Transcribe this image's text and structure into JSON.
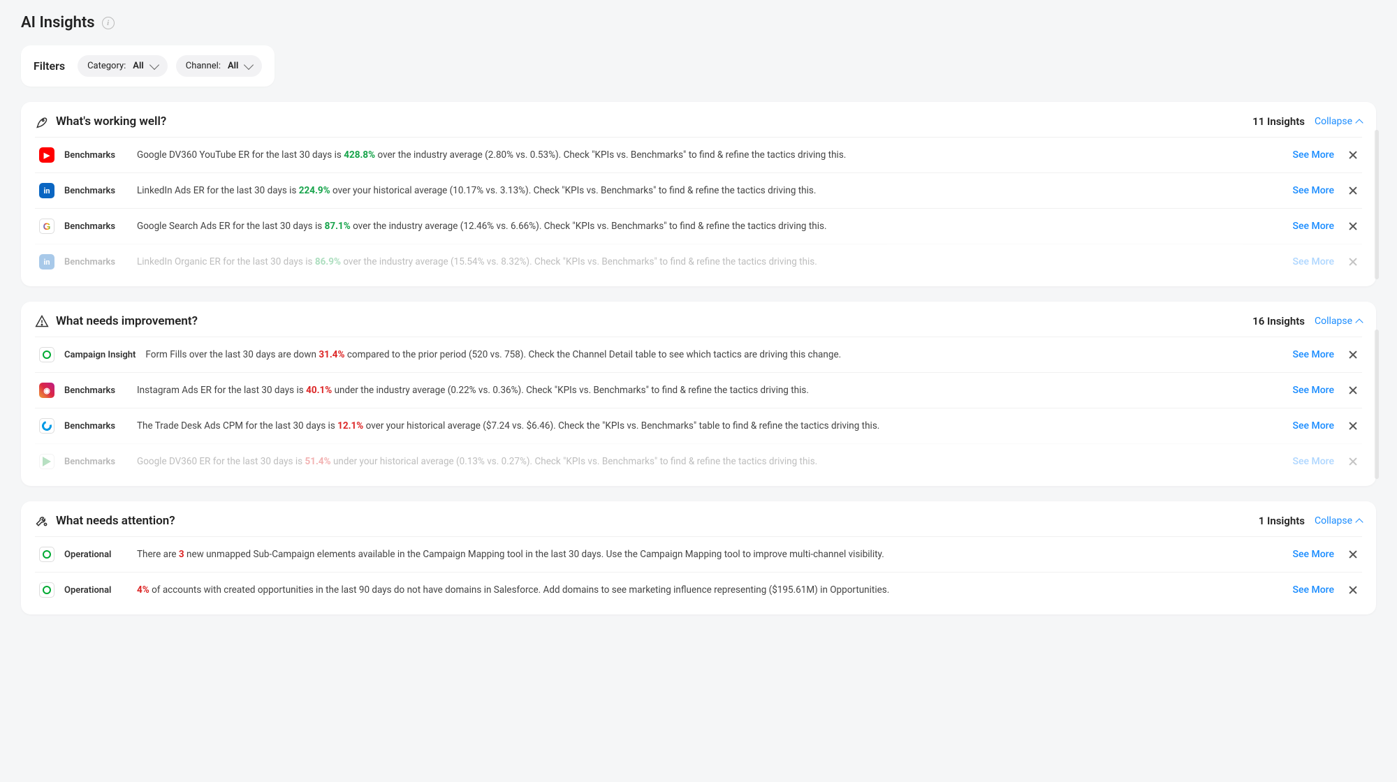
{
  "page_title": "AI Insights",
  "filters": {
    "label": "Filters",
    "category": {
      "label": "Category:",
      "value": "All"
    },
    "channel": {
      "label": "Channel:",
      "value": "All"
    }
  },
  "common": {
    "see_more": "See More",
    "collapse": "Collapse"
  },
  "sections": [
    {
      "id": "working",
      "icon": "rocket",
      "title": "What's working well?",
      "count_label": "11 Insights",
      "rows": [
        {
          "channel_icon": "youtube",
          "tag": "Benchmarks",
          "text_pre": "Google DV360 YouTube ER for the last 30 days is ",
          "metric": "428.8%",
          "metric_color": "green",
          "text_post": " over the industry average (2.80% vs. 0.53%). Check \"KPIs vs. Benchmarks\" to find & refine the tactics driving this."
        },
        {
          "channel_icon": "linkedin",
          "tag": "Benchmarks",
          "text_pre": "LinkedIn Ads ER for the last 30 days is ",
          "metric": "224.9%",
          "metric_color": "green",
          "text_post": " over your historical average (10.17% vs. 3.13%). Check \"KPIs vs. Benchmarks\" to find & refine the tactics driving this."
        },
        {
          "channel_icon": "google",
          "tag": "Benchmarks",
          "text_pre": "Google Search Ads ER for the last 30 days is ",
          "metric": "87.1%",
          "metric_color": "green",
          "text_post": " over the industry average (12.46% vs. 6.66%). Check \"KPIs vs. Benchmarks\" to find & refine the tactics driving this."
        },
        {
          "channel_icon": "linkedin",
          "tag": "Benchmarks",
          "faded": true,
          "text_pre": "LinkedIn Organic ER for the last 30 days is ",
          "metric": "86.9%",
          "metric_color": "green",
          "text_post": " over the industry average (15.54% vs. 8.32%). Check \"KPIs vs. Benchmarks\" to find & refine the tactics driving this."
        }
      ]
    },
    {
      "id": "improvement",
      "icon": "warning",
      "title": "What needs improvement?",
      "count_label": "16 Insights",
      "rows": [
        {
          "channel_icon": "generic",
          "tag": "Campaign Insight",
          "text_pre": "Form Fills over the last 30 days are down ",
          "metric": "31.4%",
          "metric_color": "red",
          "text_post": " compared to the prior period (520 vs. 758). Check the Channel Detail table to see which tactics are driving this change."
        },
        {
          "channel_icon": "instagram",
          "tag": "Benchmarks",
          "text_pre": "Instagram Ads ER for the last 30 days is ",
          "metric": "40.1%",
          "metric_color": "red",
          "text_post": " under the industry average (0.22% vs. 0.36%). Check \"KPIs vs. Benchmarks\" to find & refine the tactics driving this."
        },
        {
          "channel_icon": "tradedesk",
          "tag": "Benchmarks",
          "text_pre": "The Trade Desk Ads CPM for the last 30 days is ",
          "metric": "12.1%",
          "metric_color": "red",
          "text_post": " over your historical average ($7.24 vs. $6.46). Check the \"KPIs vs. Benchmarks\" table to find & refine the tactics driving this."
        },
        {
          "channel_icon": "dv360",
          "tag": "Benchmarks",
          "faded": true,
          "text_pre": "Google DV360 ER for the last 30 days is ",
          "metric": "51.4%",
          "metric_color": "red",
          "text_post": " under your historical average (0.13% vs. 0.27%). Check \"KPIs vs. Benchmarks\" to find & refine the tactics driving this."
        }
      ]
    },
    {
      "id": "attention",
      "icon": "wrench",
      "title": "What needs attention?",
      "count_label": "1 Insights",
      "rows": [
        {
          "channel_icon": "generic",
          "tag": "Operational",
          "text_pre": "There are ",
          "metric": "3",
          "metric_color": "red",
          "text_post": " new unmapped Sub-Campaign elements available in the Campaign Mapping tool in the last 30 days. Use the Campaign Mapping tool to improve multi-channel visibility."
        },
        {
          "channel_icon": "generic",
          "tag": "Operational",
          "text_pre": "",
          "metric": "4%",
          "metric_color": "red",
          "text_post": " of accounts with created opportunities in the last 90 days do not have domains in Salesforce. Add domains to see marketing influence representing ($195.61M) in Opportunities."
        }
      ]
    }
  ]
}
